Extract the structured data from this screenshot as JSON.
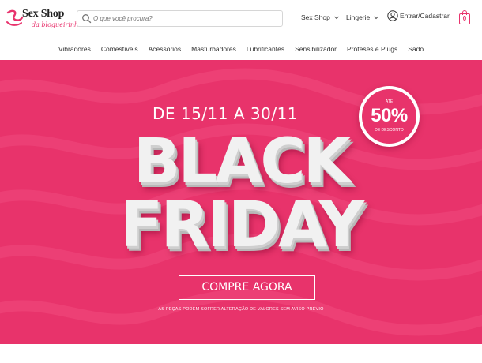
{
  "header": {
    "logo_title": "Sex Shop",
    "logo_subtitle": "da blogueirinha",
    "search_placeholder": "O que você procura?",
    "nav": [
      {
        "label": "Sex Shop",
        "icon": "chevron-down-icon"
      },
      {
        "label": "Lingerie",
        "icon": "chevron-down-icon"
      }
    ],
    "account_label": "Entrar/Cadastrar",
    "cart_count": "0"
  },
  "categories": [
    "Vibradores",
    "Comestíveis",
    "Acessórios",
    "Masturbadores",
    "Lubrificantes",
    "Sensibilizador",
    "Próteses e Plugs",
    "Sado"
  ],
  "banner": {
    "date_range": "DE 15/11 A 30/11",
    "title_line1": "BLACK",
    "title_line2": "FRIDAY",
    "badge_top": "ATÉ",
    "badge_percent": "50%",
    "badge_bottom": "DE DESCONTO",
    "cta_label": "COMPRE AGORA",
    "disclaimer": "AS PEÇAS PODEM SOFRER ALTERAÇÃO DE VALORES SEM AVISO PRÉVIO"
  },
  "colors": {
    "brand_pink": "#e8336d",
    "banner_bg": "#e8336b"
  }
}
